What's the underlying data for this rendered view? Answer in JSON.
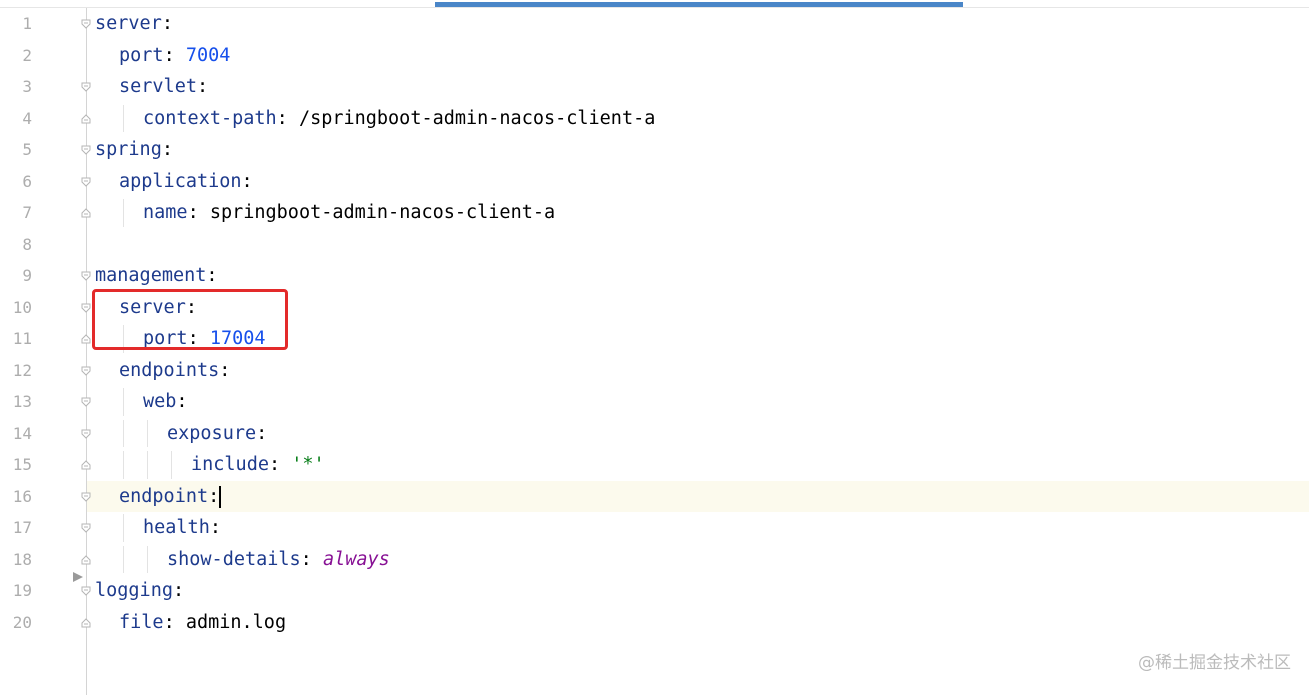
{
  "editor": {
    "current_line": 16,
    "lines": [
      {
        "number": "1",
        "indent": 0,
        "tokens": [
          {
            "text": "server",
            "kind": "key"
          },
          {
            "text": ":",
            "kind": "colon"
          }
        ]
      },
      {
        "number": "2",
        "indent": 1,
        "tokens": [
          {
            "text": "port",
            "kind": "key"
          },
          {
            "text": ": ",
            "kind": "colon"
          },
          {
            "text": "7004",
            "kind": "num"
          }
        ]
      },
      {
        "number": "3",
        "indent": 1,
        "tokens": [
          {
            "text": "servlet",
            "kind": "key"
          },
          {
            "text": ":",
            "kind": "colon"
          }
        ]
      },
      {
        "number": "4",
        "indent": 2,
        "tokens": [
          {
            "text": "context-path",
            "kind": "key"
          },
          {
            "text": ": ",
            "kind": "colon"
          },
          {
            "text": "/springboot-admin-nacos-client-a",
            "kind": "plain"
          }
        ]
      },
      {
        "number": "5",
        "indent": 0,
        "tokens": [
          {
            "text": "spring",
            "kind": "key"
          },
          {
            "text": ":",
            "kind": "colon"
          }
        ]
      },
      {
        "number": "6",
        "indent": 1,
        "tokens": [
          {
            "text": "application",
            "kind": "key"
          },
          {
            "text": ":",
            "kind": "colon"
          }
        ]
      },
      {
        "number": "7",
        "indent": 2,
        "tokens": [
          {
            "text": "name",
            "kind": "key"
          },
          {
            "text": ": ",
            "kind": "colon"
          },
          {
            "text": "springboot-admin-nacos-client-a",
            "kind": "plain"
          }
        ]
      },
      {
        "number": "8",
        "indent": 0,
        "tokens": []
      },
      {
        "number": "9",
        "indent": 0,
        "tokens": [
          {
            "text": "management",
            "kind": "key"
          },
          {
            "text": ":",
            "kind": "colon"
          }
        ]
      },
      {
        "number": "10",
        "indent": 1,
        "tokens": [
          {
            "text": "server",
            "kind": "key"
          },
          {
            "text": ":",
            "kind": "colon"
          }
        ]
      },
      {
        "number": "11",
        "indent": 2,
        "tokens": [
          {
            "text": "port",
            "kind": "key"
          },
          {
            "text": ": ",
            "kind": "colon"
          },
          {
            "text": "17004",
            "kind": "num"
          }
        ]
      },
      {
        "number": "12",
        "indent": 1,
        "tokens": [
          {
            "text": "endpoints",
            "kind": "key"
          },
          {
            "text": ":",
            "kind": "colon"
          }
        ]
      },
      {
        "number": "13",
        "indent": 2,
        "tokens": [
          {
            "text": "web",
            "kind": "key"
          },
          {
            "text": ":",
            "kind": "colon"
          }
        ]
      },
      {
        "number": "14",
        "indent": 3,
        "tokens": [
          {
            "text": "exposure",
            "kind": "key"
          },
          {
            "text": ":",
            "kind": "colon"
          }
        ]
      },
      {
        "number": "15",
        "indent": 4,
        "tokens": [
          {
            "text": "include",
            "kind": "key"
          },
          {
            "text": ": ",
            "kind": "colon"
          },
          {
            "text": "'*'",
            "kind": "str"
          }
        ]
      },
      {
        "number": "16",
        "indent": 1,
        "tokens": [
          {
            "text": "endpoint",
            "kind": "key"
          },
          {
            "text": ":",
            "kind": "colon"
          }
        ]
      },
      {
        "number": "17",
        "indent": 2,
        "tokens": [
          {
            "text": "health",
            "kind": "key"
          },
          {
            "text": ":",
            "kind": "colon"
          }
        ]
      },
      {
        "number": "18",
        "indent": 3,
        "tokens": [
          {
            "text": "show-details",
            "kind": "key"
          },
          {
            "text": ": ",
            "kind": "colon"
          },
          {
            "text": "always",
            "kind": "kw"
          }
        ]
      },
      {
        "number": "19",
        "indent": 0,
        "tokens": [
          {
            "text": "logging",
            "kind": "key"
          },
          {
            "text": ":",
            "kind": "colon"
          }
        ]
      },
      {
        "number": "20",
        "indent": 1,
        "tokens": [
          {
            "text": "file",
            "kind": "key"
          },
          {
            "text": ": ",
            "kind": "colon"
          },
          {
            "text": "admin.log",
            "kind": "plain"
          }
        ]
      }
    ],
    "fold_markers": [
      {
        "line": 1,
        "type": "open"
      },
      {
        "line": 3,
        "type": "open"
      },
      {
        "line": 4,
        "type": "close"
      },
      {
        "line": 5,
        "type": "open"
      },
      {
        "line": 6,
        "type": "open"
      },
      {
        "line": 7,
        "type": "close"
      },
      {
        "line": 9,
        "type": "open"
      },
      {
        "line": 10,
        "type": "open"
      },
      {
        "line": 11,
        "type": "close"
      },
      {
        "line": 12,
        "type": "open"
      },
      {
        "line": 13,
        "type": "open"
      },
      {
        "line": 14,
        "type": "open"
      },
      {
        "line": 15,
        "type": "close"
      },
      {
        "line": 16,
        "type": "open"
      },
      {
        "line": 17,
        "type": "open"
      },
      {
        "line": 18,
        "type": "close"
      },
      {
        "line": 19,
        "type": "open"
      },
      {
        "line": 20,
        "type": "close"
      }
    ]
  },
  "watermark": "@稀土掘金技术社区",
  "colors": {
    "key": "#1d3a8c",
    "number": "#1750eb",
    "string": "#067d17",
    "keyword": "#871094",
    "highlight_box": "#e32a2a",
    "accent": "#4a86c8"
  }
}
